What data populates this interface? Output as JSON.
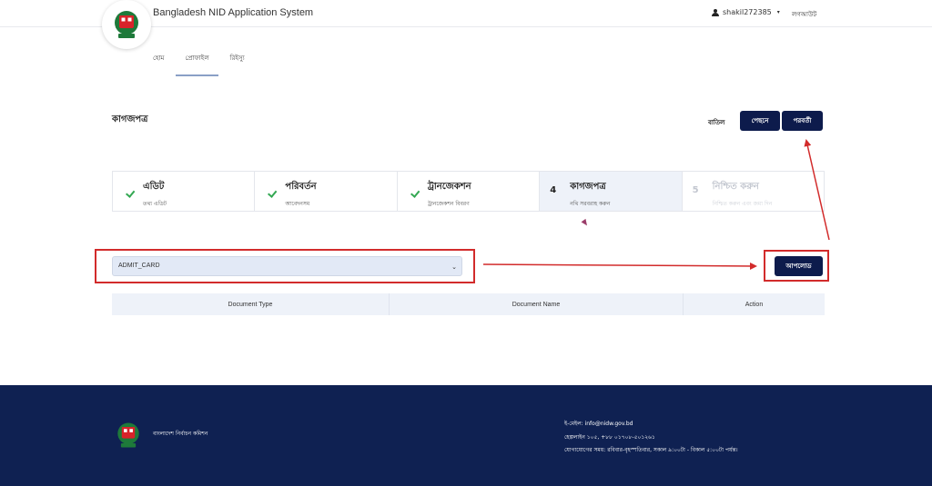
{
  "header": {
    "app_title": "Bangladesh NID Application System",
    "username": "shakil272385",
    "logout_label": "লগআউট"
  },
  "nav": {
    "items": [
      {
        "label": "হোম"
      },
      {
        "label": "প্রোফাইল"
      },
      {
        "label": "রিইস্যু"
      }
    ],
    "active_index": 1
  },
  "page": {
    "title": "কাগজপত্র",
    "cancel_label": "বাতিল",
    "back_label": "পেছনে",
    "next_label": "পরবর্তী"
  },
  "stepper": {
    "steps": [
      {
        "title": "এডিট",
        "subtitle": "তথ্য এডিট",
        "state": "done"
      },
      {
        "title": "পরিবর্তন",
        "subtitle": "আবেদনসম",
        "state": "done"
      },
      {
        "title": "ট্রানজেকশন",
        "subtitle": "ট্রানজেকশন বিবরণ",
        "state": "done"
      },
      {
        "number": "4",
        "title": "কাগজপত্র",
        "subtitle": "নথি সরবরাহ করুন",
        "state": "active"
      },
      {
        "number": "5",
        "title": "নিশ্চিত করুন",
        "subtitle": "নিশ্চিত করুন এবং জমা দিন",
        "state": "pending"
      }
    ]
  },
  "upload": {
    "selected_document": "ADMIT_CARD",
    "upload_label": "আপলোড"
  },
  "table": {
    "columns": [
      "Document Type",
      "Document Name",
      "Action"
    ]
  },
  "footer": {
    "org_name": "বাংলাদেশ নির্বাচন কমিশন",
    "email_line": "ই-মেইল: info@nidw.gov.bd",
    "hotline_line": "হেল্পলাইন ১০৫, +৮৮ ০১৭০৮-৫০১২৬১",
    "hours_line": "যোগাযোগের সময়: রবিবার-বৃহস্পতিবার, সকাল ৯:০০টা - বিকাল ৫:০০টা পর্যন্ত।"
  },
  "colors": {
    "primary_dark": "#0d1b4c",
    "footer_bg": "#0f2152",
    "success": "#34a853",
    "highlight_red": "#d22b2b"
  }
}
